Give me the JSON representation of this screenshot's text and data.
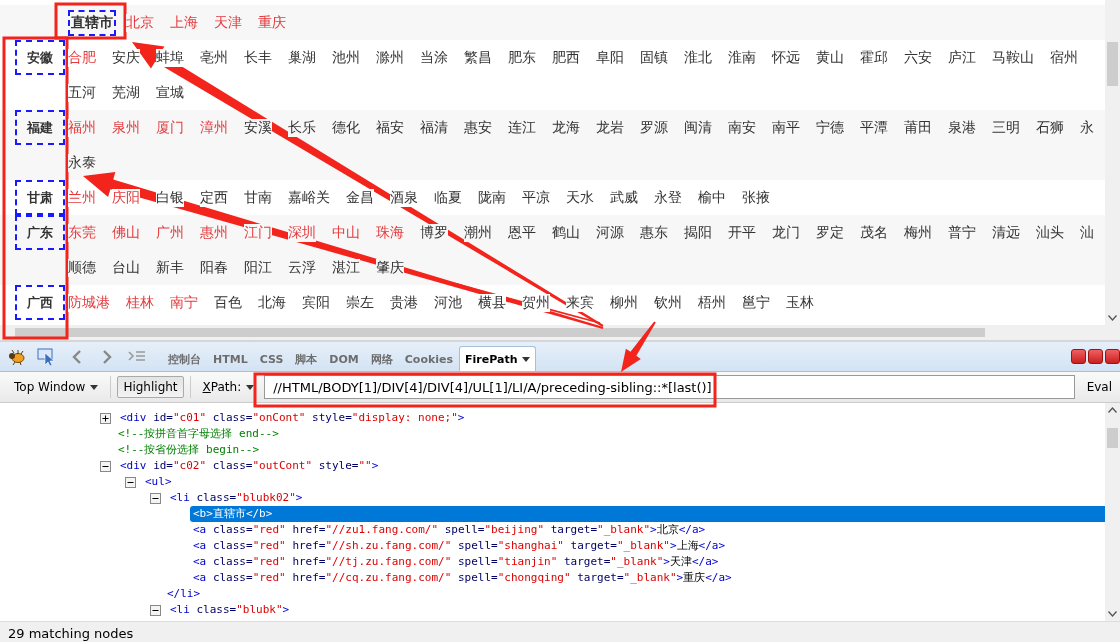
{
  "city_list": {
    "groups": [
      {
        "kind": "inline",
        "label": "直辖市",
        "lines": [
          [
            {
              "name": "北京",
              "hot": true
            },
            {
              "name": "上海",
              "hot": true
            },
            {
              "name": "天津",
              "hot": true
            },
            {
              "name": "重庆",
              "hot": true
            }
          ]
        ]
      },
      {
        "kind": "column",
        "label": "安徽",
        "lines": [
          [
            {
              "name": "合肥",
              "hot": true
            },
            {
              "name": "安庆",
              "hot": false
            },
            {
              "name": "蚌埠",
              "hot": false
            },
            {
              "name": "亳州",
              "hot": false
            },
            {
              "name": "长丰",
              "hot": false
            },
            {
              "name": "巢湖",
              "hot": false
            },
            {
              "name": "池州",
              "hot": false
            },
            {
              "name": "滁州",
              "hot": false
            },
            {
              "name": "当涂",
              "hot": false
            },
            {
              "name": "繁昌",
              "hot": false
            },
            {
              "name": "肥东",
              "hot": false
            },
            {
              "name": "肥西",
              "hot": false
            },
            {
              "name": "阜阳",
              "hot": false
            },
            {
              "name": "固镇",
              "hot": false
            },
            {
              "name": "淮北",
              "hot": false
            },
            {
              "name": "淮南",
              "hot": false
            },
            {
              "name": "怀远",
              "hot": false
            },
            {
              "name": "黄山",
              "hot": false
            },
            {
              "name": "霍邱",
              "hot": false
            },
            {
              "name": "六安",
              "hot": false
            },
            {
              "name": "庐江",
              "hot": false
            },
            {
              "name": "马鞍山",
              "hot": false
            },
            {
              "name": "宿州",
              "hot": false
            }
          ],
          [
            {
              "name": "五河",
              "hot": false
            },
            {
              "name": "芜湖",
              "hot": false
            },
            {
              "name": "宣城",
              "hot": false
            }
          ]
        ]
      },
      {
        "kind": "column",
        "label": "福建",
        "lines": [
          [
            {
              "name": "福州",
              "hot": true
            },
            {
              "name": "泉州",
              "hot": true
            },
            {
              "name": "厦门",
              "hot": true
            },
            {
              "name": "漳州",
              "hot": true
            },
            {
              "name": "安溪",
              "hot": false
            },
            {
              "name": "长乐",
              "hot": false
            },
            {
              "name": "德化",
              "hot": false
            },
            {
              "name": "福安",
              "hot": false
            },
            {
              "name": "福清",
              "hot": false
            },
            {
              "name": "惠安",
              "hot": false
            },
            {
              "name": "连江",
              "hot": false
            },
            {
              "name": "龙海",
              "hot": false
            },
            {
              "name": "龙岩",
              "hot": false
            },
            {
              "name": "罗源",
              "hot": false
            },
            {
              "name": "闽清",
              "hot": false
            },
            {
              "name": "南安",
              "hot": false
            },
            {
              "name": "南平",
              "hot": false
            },
            {
              "name": "宁德",
              "hot": false
            },
            {
              "name": "平潭",
              "hot": false
            },
            {
              "name": "莆田",
              "hot": false
            },
            {
              "name": "泉港",
              "hot": false
            },
            {
              "name": "三明",
              "hot": false
            },
            {
              "name": "石狮",
              "hot": false
            },
            {
              "name": "永",
              "hot": false
            }
          ],
          [
            {
              "name": "永泰",
              "hot": false
            }
          ]
        ]
      },
      {
        "kind": "column",
        "label": "甘肃",
        "lines": [
          [
            {
              "name": "兰州",
              "hot": true
            },
            {
              "name": "庆阳",
              "hot": true
            },
            {
              "name": "白银",
              "hot": false
            },
            {
              "name": "定西",
              "hot": false
            },
            {
              "name": "甘南",
              "hot": false
            },
            {
              "name": "嘉峪关",
              "hot": false
            },
            {
              "name": "金昌",
              "hot": false
            },
            {
              "name": "酒泉",
              "hot": false
            },
            {
              "name": "临夏",
              "hot": false
            },
            {
              "name": "陇南",
              "hot": false
            },
            {
              "name": "平凉",
              "hot": false
            },
            {
              "name": "天水",
              "hot": false
            },
            {
              "name": "武威",
              "hot": false
            },
            {
              "name": "永登",
              "hot": false
            },
            {
              "name": "榆中",
              "hot": false
            },
            {
              "name": "张掖",
              "hot": false
            }
          ]
        ]
      },
      {
        "kind": "column",
        "label": "广东",
        "lines": [
          [
            {
              "name": "东莞",
              "hot": true
            },
            {
              "name": "佛山",
              "hot": true
            },
            {
              "name": "广州",
              "hot": true
            },
            {
              "name": "惠州",
              "hot": true
            },
            {
              "name": "江门",
              "hot": true
            },
            {
              "name": "深圳",
              "hot": true
            },
            {
              "name": "中山",
              "hot": true
            },
            {
              "name": "珠海",
              "hot": true
            },
            {
              "name": "博罗",
              "hot": false
            },
            {
              "name": "潮州",
              "hot": false
            },
            {
              "name": "恩平",
              "hot": false
            },
            {
              "name": "鹤山",
              "hot": false
            },
            {
              "name": "河源",
              "hot": false
            },
            {
              "name": "惠东",
              "hot": false
            },
            {
              "name": "揭阳",
              "hot": false
            },
            {
              "name": "开平",
              "hot": false
            },
            {
              "name": "龙门",
              "hot": false
            },
            {
              "name": "罗定",
              "hot": false
            },
            {
              "name": "茂名",
              "hot": false
            },
            {
              "name": "梅州",
              "hot": false
            },
            {
              "name": "普宁",
              "hot": false
            },
            {
              "name": "清远",
              "hot": false
            },
            {
              "name": "汕头",
              "hot": false
            },
            {
              "name": "汕",
              "hot": false
            }
          ],
          [
            {
              "name": "顺德",
              "hot": false
            },
            {
              "name": "台山",
              "hot": false
            },
            {
              "name": "新丰",
              "hot": false
            },
            {
              "name": "阳春",
              "hot": false
            },
            {
              "name": "阳江",
              "hot": false
            },
            {
              "name": "云浮",
              "hot": false
            },
            {
              "name": "湛江",
              "hot": false
            },
            {
              "name": "肇庆",
              "hot": false
            }
          ]
        ]
      },
      {
        "kind": "column",
        "label": "广西",
        "lines": [
          [
            {
              "name": "防城港",
              "hot": true
            },
            {
              "name": "桂林",
              "hot": true
            },
            {
              "name": "南宁",
              "hot": true
            },
            {
              "name": "百色",
              "hot": false
            },
            {
              "name": "北海",
              "hot": false
            },
            {
              "name": "宾阳",
              "hot": false
            },
            {
              "name": "崇左",
              "hot": false
            },
            {
              "name": "贵港",
              "hot": false
            },
            {
              "name": "河池",
              "hot": false
            },
            {
              "name": "横县",
              "hot": false
            },
            {
              "name": "贺州",
              "hot": false
            },
            {
              "name": "来宾",
              "hot": false
            },
            {
              "name": "柳州",
              "hot": false
            },
            {
              "name": "钦州",
              "hot": false
            },
            {
              "name": "梧州",
              "hot": false
            },
            {
              "name": "邕宁",
              "hot": false
            },
            {
              "name": "玉林",
              "hot": false
            }
          ]
        ]
      }
    ]
  },
  "devtools": {
    "tabs": [
      {
        "label": "控制台",
        "selected": false,
        "menu": false
      },
      {
        "label": "HTML",
        "selected": false,
        "menu": false
      },
      {
        "label": "CSS",
        "selected": false,
        "menu": false
      },
      {
        "label": "脚本",
        "selected": false,
        "menu": false
      },
      {
        "label": "DOM",
        "selected": false,
        "menu": false
      },
      {
        "label": "网络",
        "selected": false,
        "menu": false
      },
      {
        "label": "Cookies",
        "selected": false,
        "menu": false
      },
      {
        "label": "FirePath",
        "selected": true,
        "menu": true
      }
    ],
    "toolbar": {
      "frame_menu": "Top Window",
      "highlight": {
        "label": "Highlight",
        "on": true
      },
      "mode_menu": "XPath:",
      "xpath": "//HTML/BODY[1]/DIV[4]/DIV[4]/UL[1]/LI/A/preceding-sibling::*[last()]",
      "eval": "Eval"
    },
    "tree": [
      {
        "kind": "branch",
        "text": "<div id=\"c01\" class=\"onCont\" style=\"display: none;\">",
        "expanded": false,
        "selected": false
      },
      {
        "kind": "leaf",
        "text": "<!--按拼音首字母选择 end-->",
        "selected": false
      },
      {
        "kind": "leaf",
        "text": "<!--按省份选择 begin-->",
        "selected": false
      },
      {
        "kind": "branch",
        "text": "<div id=\"c02\" class=\"outCont\" style=\"\">",
        "expanded": true,
        "selected": false,
        "children": [
          {
            "kind": "branch",
            "text": "<ul>",
            "expanded": true,
            "selected": false,
            "children": [
              {
                "kind": "branch",
                "text": "<li class=\"blubk02\">",
                "expanded": true,
                "selected": false,
                "closing": "</li>",
                "children": [
                  {
                    "kind": "leaf",
                    "text": "<b>直辖市</b>",
                    "selected": true
                  },
                  {
                    "kind": "leaf",
                    "text": "<a class=\"red\" href=\"//zu1.fang.com/\" spell=\"beijing\" target=\"_blank\">北京</a>",
                    "selected": false
                  },
                  {
                    "kind": "leaf",
                    "text": "<a class=\"red\" href=\"//sh.zu.fang.com/\" spell=\"shanghai\" target=\"_blank\">上海</a>",
                    "selected": false
                  },
                  {
                    "kind": "leaf",
                    "text": "<a class=\"red\" href=\"//tj.zu.fang.com/\" spell=\"tianjin\" target=\"_blank\">天津</a>",
                    "selected": false
                  },
                  {
                    "kind": "leaf",
                    "text": "<a class=\"red\" href=\"//cq.zu.fang.com/\" spell=\"chongqing\" target=\"_blank\">重庆</a>",
                    "selected": false
                  }
                ]
              },
              {
                "kind": "branch",
                "text": "<li class=\"blubk\">",
                "expanded": true,
                "selected": false
              }
            ]
          }
        ]
      }
    ],
    "status": "29 matching nodes"
  }
}
